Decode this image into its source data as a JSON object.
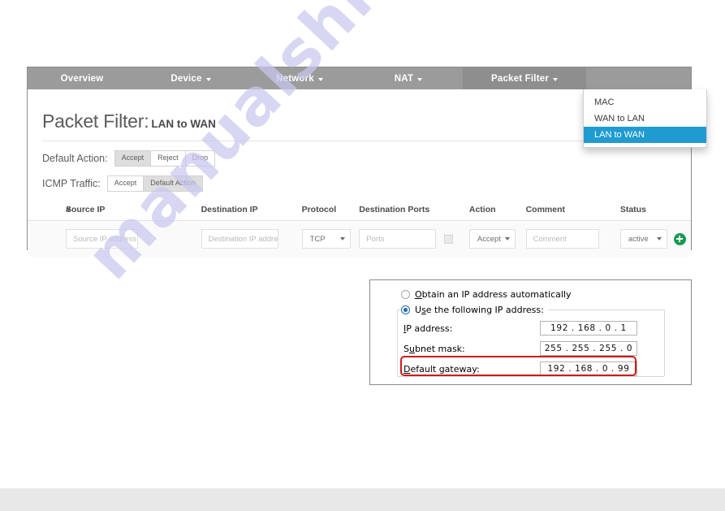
{
  "navbar": {
    "items": [
      {
        "label": "Overview",
        "has_caret": false,
        "active": false
      },
      {
        "label": "Device",
        "has_caret": true,
        "active": false
      },
      {
        "label": "Network",
        "has_caret": true,
        "active": false
      },
      {
        "label": "NAT",
        "has_caret": true,
        "active": false
      },
      {
        "label": "Packet Filter",
        "has_caret": true,
        "active": true
      }
    ]
  },
  "dropdown": {
    "items": [
      {
        "label": "MAC",
        "selected": false
      },
      {
        "label": "WAN to LAN",
        "selected": false
      },
      {
        "label": "LAN to WAN",
        "selected": true
      }
    ],
    "highlight_color": "#1f9bd1"
  },
  "page": {
    "title_main": "Packet Filter:",
    "title_sub": "LAN to WAN"
  },
  "default_action": {
    "label": "Default Action:",
    "options": [
      "Accept",
      "Reject",
      "Drop"
    ],
    "selected": "Accept"
  },
  "icmp_traffic": {
    "label": "ICMP Traffic:",
    "options": [
      "Accept",
      "Default Action"
    ],
    "selected": "Default Action"
  },
  "table": {
    "headers": [
      "#",
      "Source IP",
      "Destination IP",
      "Protocol",
      "Destination Ports",
      "Action",
      "Comment",
      "Status"
    ],
    "row": {
      "source_ip_placeholder": "Source IP address",
      "destination_ip_placeholder": "Destination IP address",
      "protocol_value": "TCP",
      "ports_placeholder": "Ports",
      "action_value": "Accept",
      "comment_placeholder": "Comment",
      "status_value": "active",
      "add_label": "+"
    }
  },
  "ip_dialog": {
    "radio_auto": "Obtain an IP address automatically",
    "radio_manual": "Use the following IP address:",
    "selected_option": "Use the following IP address:",
    "fields": [
      {
        "label": "IP address:",
        "value": "192 . 168 .  0  .  1",
        "highlighted": false
      },
      {
        "label": "Subnet mask:",
        "value": "255 . 255 . 255 .  0",
        "highlighted": false
      },
      {
        "label": "Default gateway:",
        "value": "192 . 168 .  0  . 99",
        "highlighted": true
      }
    ],
    "highlight_color": "#cc1b1b"
  },
  "watermark": {
    "text": "manualshive.com"
  }
}
